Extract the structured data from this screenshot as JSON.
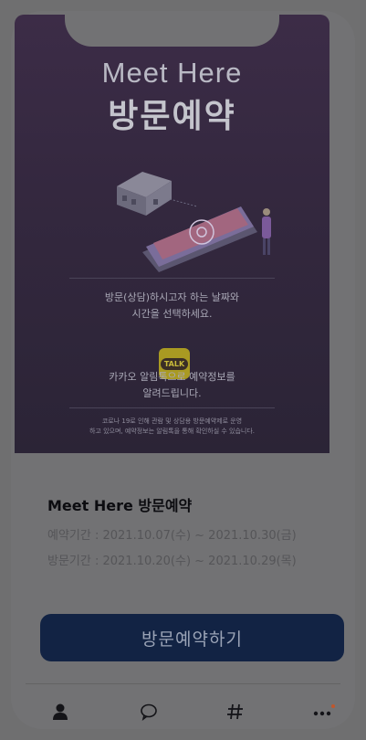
{
  "hero": {
    "title_en": "Meet Here",
    "title_ko": "방문예약",
    "desc1_line1": "방문(상담)하시고자 하는 날짜와",
    "desc1_line2": "시간을 선택하세요.",
    "kakao_badge": "TALK",
    "desc2_line1": "카카오 알림톡으로 예약정보를",
    "desc2_line2": "알려드립니다.",
    "notice_line1": "코로나 19로 인해 관람 및 상담용 방문예약제로 운영",
    "notice_line2": "하고 있으며, 예약정보는 알림톡을 통해 확인하실 수 있습니다."
  },
  "card": {
    "title": "Meet Here 방문예약",
    "reservation_period": "예약기간 : 2021.10.07(수) ~ 2021.10.30(금)",
    "visit_period": "방문기간 : 2021.10.20(수) ~ 2021.10.29(목)",
    "button_label": "방문예약하기"
  },
  "tabbar": {
    "items": [
      {
        "icon": "person-icon"
      },
      {
        "icon": "chat-icon"
      },
      {
        "icon": "hash-icon"
      },
      {
        "icon": "more-icon",
        "badge_color": "#c0562c"
      }
    ]
  }
}
